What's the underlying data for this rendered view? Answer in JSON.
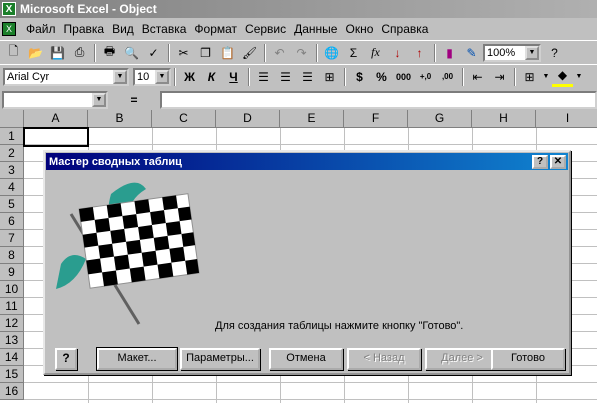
{
  "window": {
    "title": "Microsoft Excel - Object",
    "app_icon": "X"
  },
  "menu": [
    "Файл",
    "Правка",
    "Вид",
    "Вставка",
    "Формат",
    "Сервис",
    "Данные",
    "Окно",
    "Справка"
  ],
  "toolbar_standard": {
    "zoom": "100%",
    "sigma": "Σ",
    "fx": "fx"
  },
  "toolbar_format": {
    "font": "Arial Cyr",
    "size": "10",
    "bold": "Ж",
    "italic": "К",
    "underline": "Ч",
    "currency": "$",
    "percent": "%",
    "thousands": "000",
    "inc_decimal": "+,0",
    "dec_decimal": ",00"
  },
  "formula_bar": {
    "equals": "="
  },
  "sheet": {
    "columns": [
      "A",
      "B",
      "C",
      "D",
      "E",
      "F",
      "G",
      "H",
      "I"
    ],
    "rows": [
      "1",
      "2",
      "3",
      "4",
      "5",
      "6",
      "7",
      "8",
      "9",
      "10",
      "11",
      "12",
      "13",
      "14",
      "15",
      "16"
    ]
  },
  "dialog": {
    "title": "Мастер сводных таблиц",
    "help_label": "?",
    "close_label": "✕",
    "message": "Для создания таблицы нажмите кнопку \"Готово\".",
    "buttons": {
      "layout": "Макет...",
      "options": "Параметры...",
      "cancel": "Отмена",
      "back": "< Назад",
      "next": "Далее >",
      "finish": "Готово"
    }
  },
  "colors": {
    "dialog_title_start": "#00007b",
    "dialog_title_end": "#1084d0",
    "flag_teal": "#2a9d8f",
    "window_face": "#c0c0c0"
  }
}
